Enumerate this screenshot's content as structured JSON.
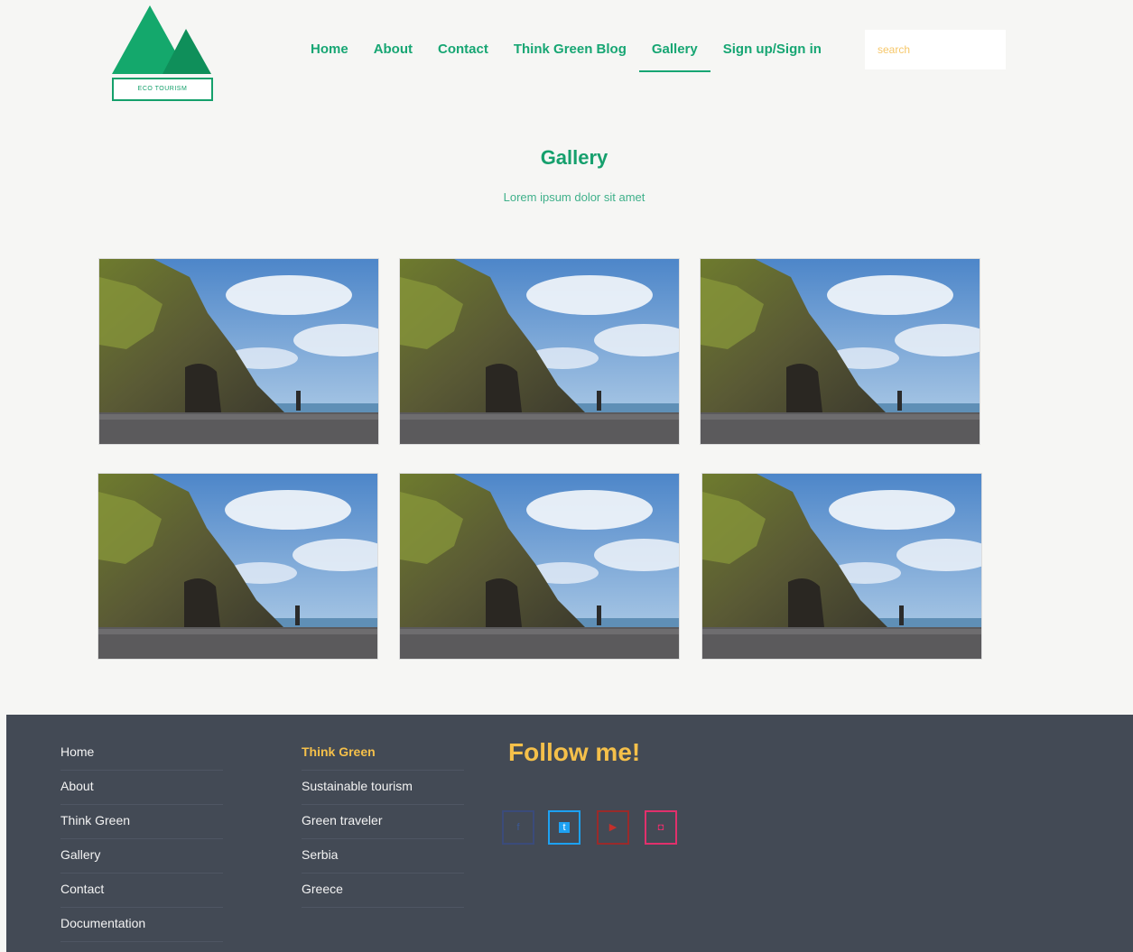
{
  "logo": {
    "text": "ECO TOURISM"
  },
  "nav": [
    {
      "label": "Home"
    },
    {
      "label": "About"
    },
    {
      "label": "Contact"
    },
    {
      "label": "Think Green Blog"
    },
    {
      "label": "Gallery",
      "active": true
    },
    {
      "label": "Sign up/Sign in"
    }
  ],
  "search": {
    "placeholder": "search"
  },
  "main": {
    "title": "Gallery",
    "subtitle": "Lorem ipsum dolor sit amet"
  },
  "gallery": {
    "image_count": 6
  },
  "footer": {
    "col1": [
      {
        "label": "Home"
      },
      {
        "label": "About"
      },
      {
        "label": "Think Green"
      },
      {
        "label": "Gallery"
      },
      {
        "label": "Contact"
      },
      {
        "label": "Documentation"
      }
    ],
    "col2": [
      {
        "label": "Think Green"
      },
      {
        "label": "Sustainable tourism"
      },
      {
        "label": "Green traveler"
      },
      {
        "label": "Serbia"
      },
      {
        "label": "Greece"
      }
    ],
    "follow_title": "Follow me!",
    "social": [
      {
        "icon": "facebook-icon",
        "glyph": "f",
        "color": "#3b5998"
      },
      {
        "icon": "twitter-icon",
        "glyph": "t",
        "color": "#1da1f2"
      },
      {
        "icon": "youtube-icon",
        "glyph": "▶",
        "color": "#c4302b"
      },
      {
        "icon": "instagram-icon",
        "glyph": "◘",
        "color": "#e1306c"
      }
    ]
  },
  "colors": {
    "brand_green": "#17a673",
    "accent_yellow": "#f5c04a",
    "footer_bg": "#434a55"
  }
}
